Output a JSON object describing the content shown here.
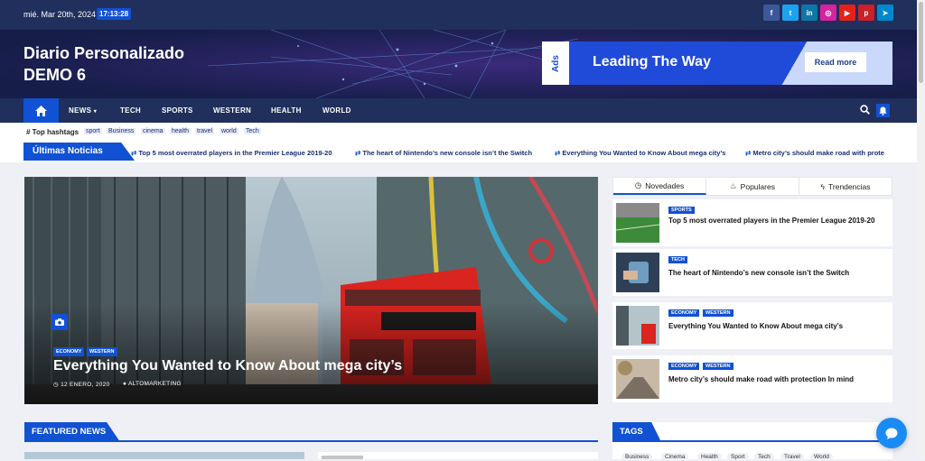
{
  "topbar": {
    "date": "mié. Mar 20th, 2024",
    "time": "17:13:28",
    "social": [
      {
        "icon": "facebook-icon",
        "glyph": "f",
        "color": "#3b5998"
      },
      {
        "icon": "twitter-icon",
        "glyph": "t",
        "color": "#1da1f2"
      },
      {
        "icon": "linkedin-icon",
        "glyph": "in",
        "color": "#0e76a8"
      },
      {
        "icon": "instagram-icon",
        "glyph": "◎",
        "color": "#d6249f"
      },
      {
        "icon": "youtube-icon",
        "glyph": "▶",
        "color": "#e62117"
      },
      {
        "icon": "pinterest-icon",
        "glyph": "p",
        "color": "#cb2027"
      },
      {
        "icon": "telegram-icon",
        "glyph": "➤",
        "color": "#0088cc"
      }
    ]
  },
  "header": {
    "title_line1": "Diario Personalizado",
    "title_line2": "DEMO 6",
    "ad": {
      "tag": "Ads",
      "headline": "Leading The Way",
      "button": "Read more"
    }
  },
  "nav": {
    "items": [
      "NEWS",
      "TECH",
      "SPORTS",
      "WESTERN",
      "HEALTH",
      "WORLD"
    ]
  },
  "hashtags": {
    "label": "Top hashtags",
    "tags": [
      "sport",
      "Business",
      "cinema",
      "health",
      "travel",
      "world",
      "Tech"
    ]
  },
  "ticker": {
    "label": "Últimas Noticias",
    "items": [
      "Top 5 most overrated players in the Premier League 2019-20",
      "The heart of Nintendo’s new console isn’t the Switch",
      "Everything You Wanted to Know About mega city’s",
      "Metro city’s should make road with prote"
    ]
  },
  "hero": {
    "categories": [
      "ECONOMY",
      "WESTERN"
    ],
    "title": "Everything You Wanted to Know About mega city’s",
    "date": "12 ENERO, 2020",
    "author": "ALTOMARKETING"
  },
  "sidebar": {
    "tabs": [
      "Novedades",
      "Populares",
      "Trendencias"
    ],
    "posts": [
      {
        "categories": [
          "SPORTS"
        ],
        "title": "Top 5 most overrated players in the Premier League 2019-20"
      },
      {
        "categories": [
          "TECH"
        ],
        "title": "The heart of Nintendo’s new console isn’t the Switch"
      },
      {
        "categories": [
          "ECONOMY",
          "WESTERN"
        ],
        "title": "Everything You Wanted to Know About mega city’s"
      },
      {
        "categories": [
          "ECONOMY",
          "WESTERN"
        ],
        "title": "Metro city’s should make road with protection In mind"
      }
    ]
  },
  "featured": {
    "label": "FEATURED NEWS"
  },
  "tags_widget": {
    "label": "TAGS",
    "chips": [
      "Business",
      "Cinema",
      "Health",
      "Sport",
      "Tech",
      "Travel",
      "World"
    ]
  },
  "colors": {
    "primary": "#1151d3",
    "navy": "#202f5b"
  }
}
